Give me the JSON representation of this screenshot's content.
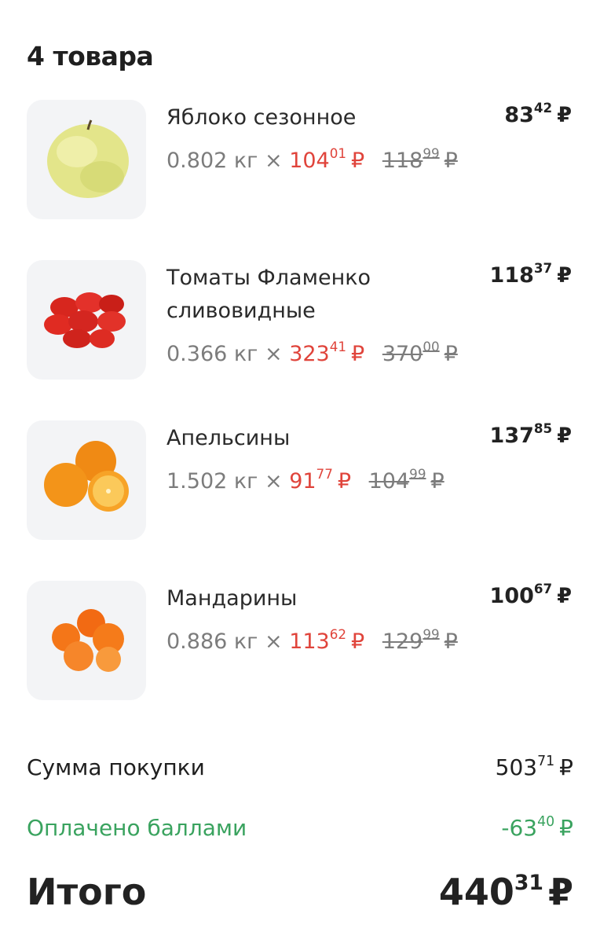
{
  "header": {
    "title": "4 товара"
  },
  "currency": "₽",
  "items": [
    {
      "name": "Яблоко сезонное",
      "total_int": "83",
      "total_frac": "42",
      "qty": "0.802 кг",
      "times": "×",
      "price_int": "104",
      "price_frac": "01",
      "old_int": "118",
      "old_frac": "99",
      "icon": "apple-icon"
    },
    {
      "name": "Томаты Фламенко сливовидные",
      "total_int": "118",
      "total_frac": "37",
      "qty": "0.366 кг",
      "times": "×",
      "price_int": "323",
      "price_frac": "41",
      "old_int": "370",
      "old_frac": "00",
      "icon": "tomatoes-icon"
    },
    {
      "name": "Апельсины",
      "total_int": "137",
      "total_frac": "85",
      "qty": "1.502 кг",
      "times": "×",
      "price_int": "91",
      "price_frac": "77",
      "old_int": "104",
      "old_frac": "99",
      "icon": "oranges-icon"
    },
    {
      "name": "Мандарины",
      "total_int": "100",
      "total_frac": "67",
      "qty": "0.886 кг",
      "times": "×",
      "price_int": "113",
      "price_frac": "62",
      "old_int": "129",
      "old_frac": "99",
      "icon": "tangerines-icon"
    }
  ],
  "summary": {
    "subtotal_label": "Сумма покупки",
    "subtotal_int": "503",
    "subtotal_frac": "71",
    "points_label": "Оплачено баллами",
    "points_int": "-63",
    "points_frac": "40",
    "total_label": "Итого",
    "total_int": "440",
    "total_frac": "31"
  },
  "colors": {
    "discount": "#e0443b",
    "points": "#3aa35f",
    "thumb_bg": "#f3f4f6"
  }
}
